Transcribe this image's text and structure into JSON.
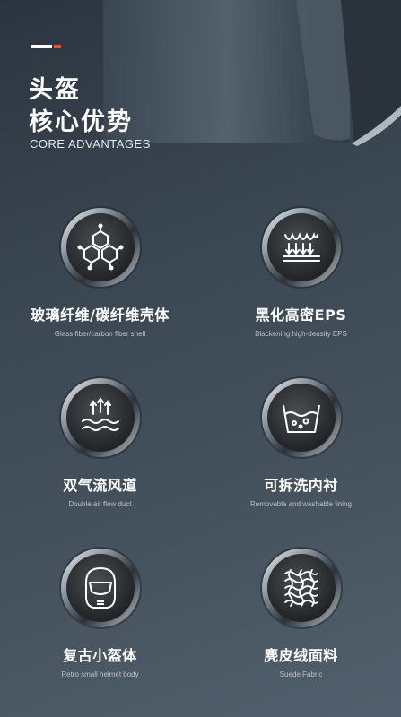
{
  "header": {
    "title_line1": "头盔",
    "title_line2": "核心优势",
    "subtitle": "CORE ADVANTAGES"
  },
  "colors": {
    "accent_orange": "#e8552a",
    "background": "#3a4651"
  },
  "features": [
    {
      "title": "玻璃纤维/碳纤维壳体",
      "subtitle": "Glass fiber/carbon fiber shell",
      "icon": "molecule-icon"
    },
    {
      "title": "黑化高密EPS",
      "subtitle": "Blackening high-density EPS",
      "icon": "layer-compress-icon"
    },
    {
      "title": "双气流风道",
      "subtitle": "Double air flow duct",
      "icon": "airflow-icon"
    },
    {
      "title": "可拆洗内衬",
      "subtitle": "Removable and washable lining",
      "icon": "wash-basin-icon"
    },
    {
      "title": "复古小盔体",
      "subtitle": "Retro small helmet body",
      "icon": "helmet-icon"
    },
    {
      "title": "麂皮绒面料",
      "subtitle": "Suede Fabric",
      "icon": "fabric-weave-icon"
    }
  ]
}
